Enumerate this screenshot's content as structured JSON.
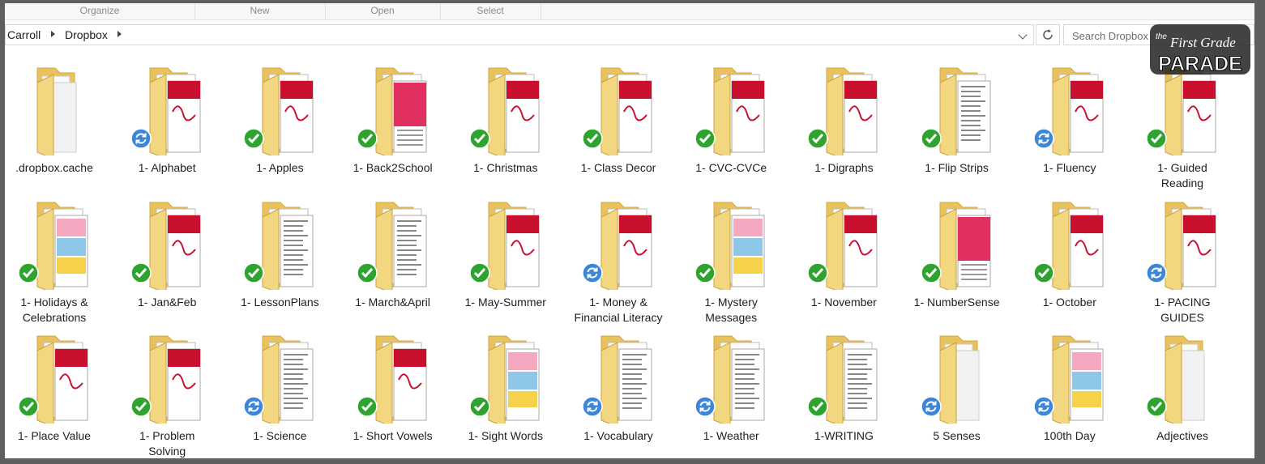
{
  "ribbon": {
    "groups": [
      "Organize",
      "New",
      "Open",
      "Select"
    ]
  },
  "breadcrumb": [
    "Carroll",
    "Dropbox"
  ],
  "search": {
    "placeholder": "Search Dropbox"
  },
  "logo": {
    "text_top": "the",
    "text_mid": "First Grade",
    "text_main": "PARADE"
  },
  "folders": [
    {
      "name": ".dropbox.cache",
      "status": "none",
      "thumb": "plain"
    },
    {
      "name": "1- Alphabet",
      "status": "sync",
      "thumb": "pdf"
    },
    {
      "name": "1- Apples",
      "status": "ok",
      "thumb": "pdf"
    },
    {
      "name": "1- Back2School",
      "status": "ok",
      "thumb": "pink"
    },
    {
      "name": "1- Christmas",
      "status": "ok",
      "thumb": "pdf"
    },
    {
      "name": "1- Class Decor",
      "status": "ok",
      "thumb": "pdf"
    },
    {
      "name": "1- CVC-CVCe",
      "status": "ok",
      "thumb": "pdf"
    },
    {
      "name": "1- Digraphs",
      "status": "ok",
      "thumb": "pdf"
    },
    {
      "name": "1- Flip Strips",
      "status": "ok",
      "thumb": "doc"
    },
    {
      "name": "1- Fluency",
      "status": "sync",
      "thumb": "pdf"
    },
    {
      "name": "1- Guided\nReading",
      "status": "ok",
      "thumb": "pdf"
    },
    {
      "name": "1- Holidays &\nCelebrations",
      "status": "ok",
      "thumb": "color"
    },
    {
      "name": "1- Jan&Feb",
      "status": "ok",
      "thumb": "pdf"
    },
    {
      "name": "1- LessonPlans",
      "status": "ok",
      "thumb": "doc"
    },
    {
      "name": "1- March&April",
      "status": "ok",
      "thumb": "doc"
    },
    {
      "name": "1- May-Summer",
      "status": "ok",
      "thumb": "pdf"
    },
    {
      "name": "1- Money &\nFinancial Literacy",
      "status": "sync",
      "thumb": "pdf"
    },
    {
      "name": "1- Mystery\nMessages",
      "status": "ok",
      "thumb": "color"
    },
    {
      "name": "1- November",
      "status": "ok",
      "thumb": "pdf"
    },
    {
      "name": "1- NumberSense",
      "status": "ok",
      "thumb": "pink"
    },
    {
      "name": "1- October",
      "status": "ok",
      "thumb": "pdf"
    },
    {
      "name": "1- PACING\nGUIDES",
      "status": "sync",
      "thumb": "pdf"
    },
    {
      "name": "1- Place Value",
      "status": "ok",
      "thumb": "pdf"
    },
    {
      "name": "1- Problem\nSolving",
      "status": "ok",
      "thumb": "pdf"
    },
    {
      "name": "1- Science",
      "status": "sync",
      "thumb": "doc"
    },
    {
      "name": "1- Short Vowels",
      "status": "ok",
      "thumb": "pdf"
    },
    {
      "name": "1- Sight Words",
      "status": "ok",
      "thumb": "color"
    },
    {
      "name": "1- Vocabulary",
      "status": "sync",
      "thumb": "doc"
    },
    {
      "name": "1- Weather",
      "status": "sync",
      "thumb": "doc"
    },
    {
      "name": "1-WRITING",
      "status": "ok",
      "thumb": "doc"
    },
    {
      "name": "5 Senses",
      "status": "sync",
      "thumb": "plain"
    },
    {
      "name": "100th Day",
      "status": "sync",
      "thumb": "color"
    },
    {
      "name": "Adjectives",
      "status": "ok",
      "thumb": "plain"
    }
  ],
  "colors": {
    "folder_front": "#f3d780",
    "folder_back": "#e9c25e",
    "sync_ok": "#2fa32f",
    "sync_pending": "#3b86d8",
    "pdf_red": "#c8102e",
    "pink_thumb": "#e0305f"
  }
}
